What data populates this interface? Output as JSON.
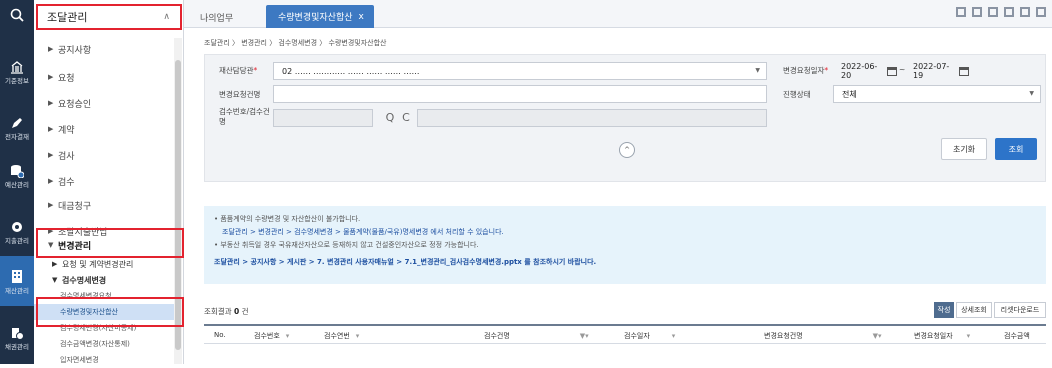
{
  "rail": {
    "items": [
      {
        "label": "기준정보",
        "icon": "building-icon"
      },
      {
        "label": "전자결재",
        "icon": "pen-icon"
      },
      {
        "label": "예산관리",
        "icon": "database-icon"
      },
      {
        "label": "지출관리",
        "icon": "gear-icon"
      },
      {
        "label": "재산관리",
        "icon": "bank-icon"
      },
      {
        "label": "채권관리",
        "icon": "coins-icon"
      }
    ]
  },
  "menu": {
    "header": "조달관리",
    "items": [
      "공지사항",
      "요청",
      "요청승인",
      "계약",
      "검사",
      "검수",
      "대금청구",
      "조달지출반납",
      "변경관리"
    ],
    "sub": [
      "요청 및 계약변경관리",
      "검수명세변경"
    ],
    "subsub": [
      "검수명세변경요청",
      "수량변경및자산합산",
      "검수명세변경(자산미통제)",
      "검수금액변경(자산통제)",
      "입자면세변경"
    ]
  },
  "tabs": {
    "home": "나의업무",
    "active": "수량변경및자산합산",
    "close": "x"
  },
  "breadcrumb": "조달관리 〉 변경관리 〉 검수명세변경 〉 수량변경및자산합산",
  "form": {
    "dept_label": "재산담당관",
    "dept_value": "02 ……  …………  ……  ……  ……  ……",
    "req_date_label": "변경요청일자",
    "date_from": "2022-06-20",
    "date_sep": "~",
    "date_to": "2022-07-19",
    "change_name_label": "변경요청건명",
    "status_label": "진행상태",
    "status_value": "전체",
    "inspect_label_1": "검수번호/검수건",
    "inspect_label_2": "명",
    "search_icon": "Q",
    "reset_icon": "C",
    "expand_icon": "^",
    "reset_button": "초기화",
    "search_button": "조회"
  },
  "notice": {
    "line1": "• 품품계약의 수량변경 및 자산합산이 불가합니다.",
    "line2": "조달관리 > 변경관리 > 검수명세변경 > 물품계약(물품/국유)명세변경 에서 처리할 수 있습니다.",
    "line3": "• 부동산 취득일 경우 국유재산자산으로 등재하지 않고 건설중인자산으로 정정 가능합니다.",
    "line4": "조달관리 > 공지사항 > 게시판 > 7. 변경관리 사용자매뉴얼 > 7.1_변경관리_검사검수명세변경.pptx 를 참조하시기 바랍니다."
  },
  "results": {
    "label": "조회결과",
    "count": "0",
    "unit": "건",
    "btn_write": "작성",
    "btn_detail": "상세조회",
    "btn_download": "리셋다운로드"
  },
  "grid": {
    "columns": [
      "No.",
      "검수번호",
      "검수연번",
      "검수건명",
      "검수일자",
      "변경요청건명",
      "변경요청일자",
      "검수금액"
    ]
  }
}
